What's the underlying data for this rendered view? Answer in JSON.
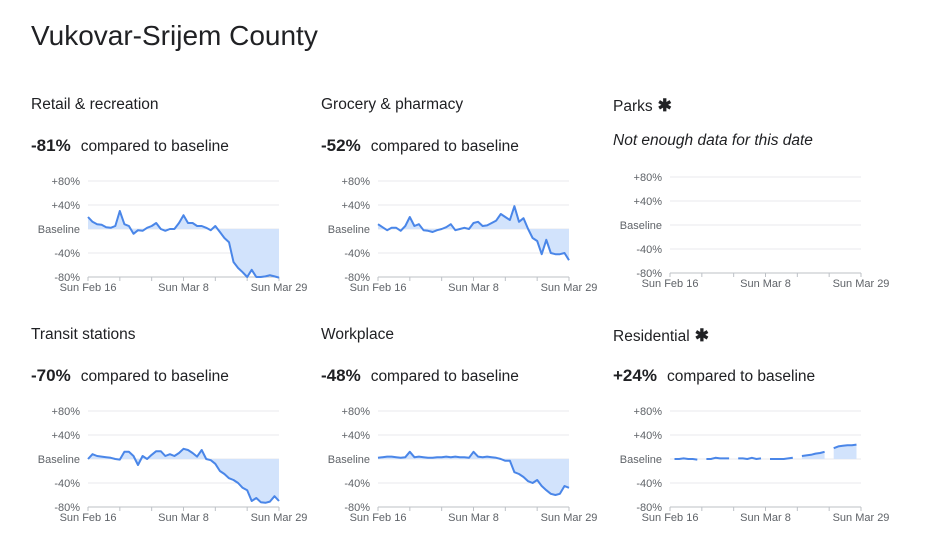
{
  "page_title": "Vukovar-Srijem County",
  "compare_suffix": "compared to baseline",
  "colors": {
    "line": "#4a86e8",
    "fill": "#d2e3fc",
    "grid": "#e8eaed"
  },
  "chart_data": [
    {
      "type": "area",
      "title": "Retail & recreation",
      "asterisk": false,
      "headline": "-81%",
      "y_ticks": [
        "+80%",
        "+40%",
        "Baseline",
        "-40%",
        "-80%"
      ],
      "ylim": [
        -80,
        80
      ],
      "x_ticks": [
        "Sun Feb 16",
        "Sun Mar 8",
        "Sun Mar 29"
      ],
      "x_range": [
        "Feb 16",
        "Mar 29"
      ],
      "values": [
        20,
        12,
        8,
        7,
        3,
        2,
        5,
        30,
        8,
        5,
        -8,
        -2,
        -3,
        2,
        5,
        10,
        0,
        -3,
        0,
        0,
        10,
        23,
        10,
        10,
        5,
        5,
        2,
        -2,
        5,
        -5,
        -15,
        -22,
        -55,
        -65,
        -72,
        -80,
        -68,
        -80,
        -80,
        -79,
        -77,
        -79,
        -81
      ]
    },
    {
      "type": "area",
      "title": "Grocery & pharmacy",
      "asterisk": false,
      "headline": "-52%",
      "y_ticks": [
        "+80%",
        "+40%",
        "Baseline",
        "-40%",
        "-80%"
      ],
      "ylim": [
        -80,
        80
      ],
      "x_ticks": [
        "Sun Feb 16",
        "Sun Mar 8",
        "Sun Mar 29"
      ],
      "x_range": [
        "Feb 16",
        "Mar 29"
      ],
      "values": [
        8,
        3,
        -2,
        2,
        2,
        -3,
        5,
        20,
        5,
        8,
        -2,
        -3,
        -5,
        -2,
        0,
        3,
        8,
        -2,
        0,
        2,
        0,
        10,
        12,
        5,
        6,
        10,
        14,
        25,
        20,
        15,
        38,
        12,
        18,
        0,
        -15,
        -20,
        -42,
        -18,
        -40,
        -42,
        -42,
        -40,
        -52
      ]
    },
    {
      "type": "area",
      "title": "Parks",
      "asterisk": true,
      "headline": "",
      "no_data": "Not enough data for this date",
      "y_ticks": [
        "+80%",
        "+40%",
        "Baseline",
        "-40%",
        "-80%"
      ],
      "ylim": [
        -80,
        80
      ],
      "x_ticks": [
        "Sun Feb 16",
        "Sun Mar 8",
        "Sun Mar 29"
      ],
      "x_range": [
        "Feb 16",
        "Mar 29"
      ],
      "values": []
    },
    {
      "type": "area",
      "title": "Transit stations",
      "asterisk": false,
      "headline": "-70%",
      "y_ticks": [
        "+80%",
        "+40%",
        "Baseline",
        "-40%",
        "-80%"
      ],
      "ylim": [
        -80,
        80
      ],
      "x_ticks": [
        "Sun Feb 16",
        "Sun Mar 8",
        "Sun Mar 29"
      ],
      "x_range": [
        "Feb 16",
        "Mar 29"
      ],
      "values": [
        0,
        8,
        5,
        4,
        3,
        2,
        0,
        -1,
        12,
        12,
        5,
        -10,
        5,
        0,
        7,
        13,
        13,
        5,
        8,
        5,
        10,
        17,
        15,
        10,
        4,
        15,
        0,
        -2,
        -8,
        -20,
        -25,
        -32,
        -35,
        -40,
        -48,
        -52,
        -70,
        -65,
        -72,
        -73,
        -71,
        -62,
        -70
      ]
    },
    {
      "type": "area",
      "title": "Workplace",
      "asterisk": false,
      "headline": "-48%",
      "y_ticks": [
        "+80%",
        "+40%",
        "Baseline",
        "-40%",
        "-80%"
      ],
      "ylim": [
        -80,
        80
      ],
      "x_ticks": [
        "Sun Feb 16",
        "Sun Mar 8",
        "Sun Mar 29"
      ],
      "x_range": [
        "Feb 16",
        "Mar 29"
      ],
      "values": [
        2,
        3,
        4,
        4,
        3,
        2,
        3,
        12,
        3,
        4,
        3,
        2,
        2,
        3,
        3,
        4,
        3,
        4,
        3,
        3,
        2,
        12,
        4,
        3,
        4,
        3,
        2,
        0,
        -3,
        -3,
        -22,
        -25,
        -30,
        -37,
        -40,
        -35,
        -45,
        -52,
        -58,
        -60,
        -58,
        -45,
        -48
      ]
    },
    {
      "type": "area",
      "title": "Residential",
      "asterisk": true,
      "headline": "+24%",
      "y_ticks": [
        "+80%",
        "+40%",
        "Baseline",
        "-40%",
        "-80%"
      ],
      "ylim": [
        -80,
        80
      ],
      "x_ticks": [
        "Sun Feb 16",
        "Sun Mar 8",
        "Sun Mar 29"
      ],
      "x_range": [
        "Feb 16",
        "Mar 29"
      ],
      "values": [
        null,
        0,
        0,
        1,
        0,
        0,
        -1,
        null,
        0,
        0,
        2,
        1,
        1,
        1,
        null,
        1,
        1,
        0,
        2,
        0,
        1,
        null,
        0,
        0,
        0,
        0,
        1,
        2,
        null,
        5,
        6,
        7,
        9,
        10,
        12,
        null,
        18,
        21,
        22,
        23,
        23,
        24,
        null
      ]
    }
  ]
}
